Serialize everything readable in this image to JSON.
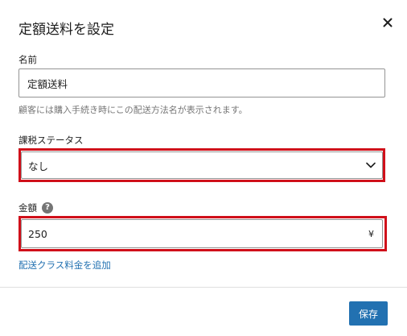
{
  "modal": {
    "title": "定額送料を設定"
  },
  "name_field": {
    "label": "名前",
    "value": "定額送料",
    "help": "顧客には購入手続き時にこの配送方法名が表示されます。"
  },
  "tax_status": {
    "label": "課税ステータス",
    "selected": "なし"
  },
  "amount": {
    "label": "金額",
    "value": "250",
    "currency_symbol": "¥"
  },
  "links": {
    "add_shipping_class_cost": "配送クラス料金を追加"
  },
  "footer": {
    "save_label": "保存"
  },
  "colors": {
    "accent": "#2271b1",
    "highlight": "#d0101a",
    "help_text": "#757575"
  },
  "icons": {
    "close": "close-icon",
    "help": "help-circle-icon",
    "dropdown": "chevron-down-icon"
  }
}
